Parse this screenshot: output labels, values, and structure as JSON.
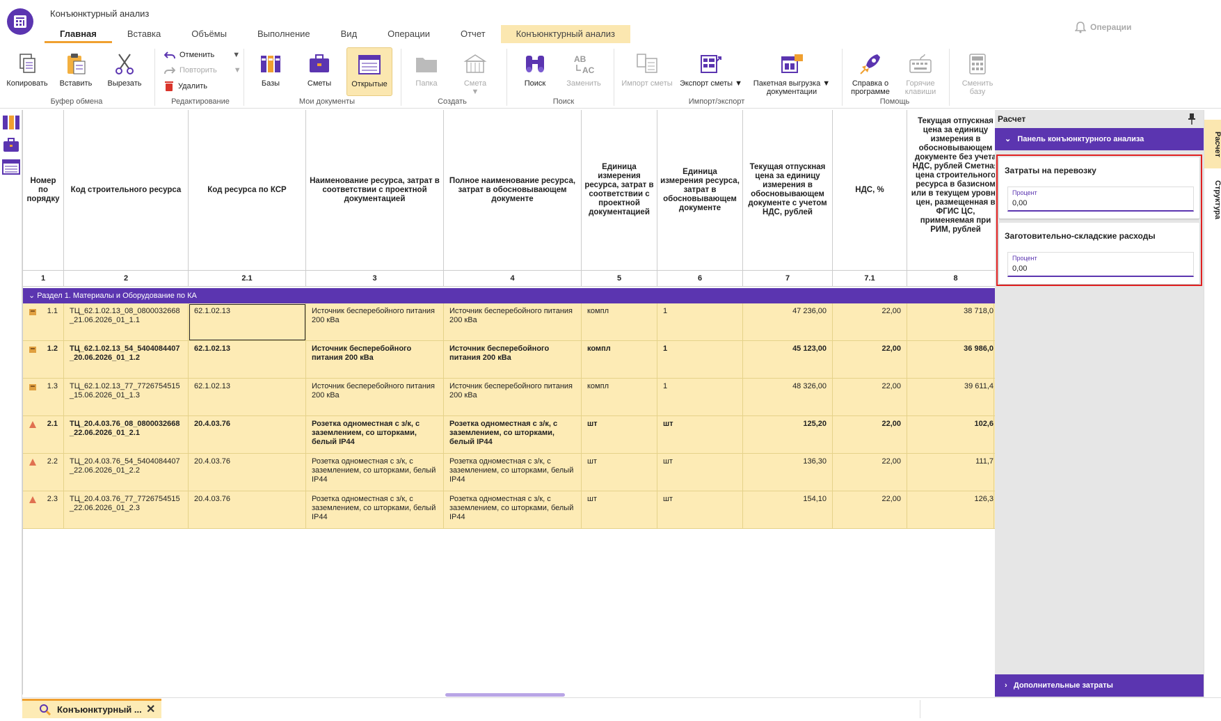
{
  "app": {
    "title": "Конъюнктурный анализ",
    "tabs": [
      "Главная",
      "Вставка",
      "Объёмы",
      "Выполнение",
      "Вид",
      "Операции",
      "Отчет",
      "Конъюнктурный анализ"
    ],
    "ops_label": "Операции"
  },
  "ribbon": {
    "copy": "Копировать",
    "paste": "Вставить",
    "cut": "Вырезать",
    "clipboard_group": "Буфер обмена",
    "undo": "Отменить",
    "redo": "Повторить",
    "delete": "Удалить",
    "edit_group": "Редактирование",
    "bases": "Базы",
    "estimates": "Сметы",
    "opened": "Открытые",
    "mydocs_group": "Мои документы",
    "folder": "Папка",
    "estimate": "Смета",
    "create_group": "Создать",
    "search": "Поиск",
    "replace": "Заменить",
    "search_group": "Поиск",
    "import_estimate": "Импорт сметы",
    "export_estimate": "Экспорт сметы",
    "batch_export_1": "Пакетная выгрузка",
    "batch_export_2": "документации",
    "import_export_group": "Импорт/экспорт",
    "help_1": "Справка о",
    "help_2": "программе",
    "hotkeys_1": "Горячие",
    "hotkeys_2": "клавиши",
    "help_group": "Помощь",
    "switch_base_1": "Сменить",
    "switch_base_2": "базу"
  },
  "grid": {
    "headers": [
      "Номер по порядку",
      "Код строительного ресурса",
      "Код ресурса по КСР",
      "Наименование ресурса, затрат в соответствии с проектной документацией",
      "Полное наименование ресурса, затрат в обосновывающем документе",
      "Единица измерения ресурса, затрат в соответствии с проектной документацией",
      "Единица измерения ресурса, затрат в обосновывающем документе",
      "Текущая отпускная цена за единицу измерения в обосновывающем документе с учетом НДС, рублей",
      "НДС, %",
      "Текущая отпускная цена за единицу измерения в обосновывающем документе без учета НДС, рублей Сметная цена строительного ресурса в базисном или в текущем уровне цен, размещенная в ФГИС ЦС, применяемая при РИМ, рублей"
    ],
    "numbers": [
      "1",
      "2",
      "2.1",
      "3",
      "4",
      "5",
      "6",
      "7",
      "7.1",
      "8"
    ],
    "section": "Раздел 1. Материалы и Оборудование по КА",
    "rows": [
      {
        "num": "1.1",
        "code": "ТЦ_62.1.02.13_08_0800032668 _21.06.2026_01_1.1",
        "ksr": "62.1.02.13",
        "name": "Источник бесперебойного питания 200 кВа",
        "full": "Источник бесперебойного питания 200 кВа",
        "unit1": "компл",
        "unit2": "1",
        "price": "47 236,00",
        "vat": "22,00",
        "net": "38 718,0"
      },
      {
        "num": "1.2",
        "code": "ТЦ_62.1.02.13_54_5404084407 _20.06.2026_01_1.2",
        "ksr": "62.1.02.13",
        "name": "Источник бесперебойного питания 200 кВа",
        "full": "Источник бесперебойного питания 200 кВа",
        "unit1": "компл",
        "unit2": "1",
        "price": "45 123,00",
        "vat": "22,00",
        "net": "36 986,0"
      },
      {
        "num": "1.3",
        "code": "ТЦ_62.1.02.13_77_7726754515 _15.06.2026_01_1.3",
        "ksr": "62.1.02.13",
        "name": "Источник бесперебойного питания 200 кВа",
        "full": "Источник бесперебойного питания 200 кВа",
        "unit1": "компл",
        "unit2": "1",
        "price": "48 326,00",
        "vat": "22,00",
        "net": "39 611,4"
      },
      {
        "num": "2.1",
        "code": "ТЦ_20.4.03.76_08_0800032668 _22.06.2026_01_2.1",
        "ksr": "20.4.03.76",
        "name": "Розетка одноместная с з/к, с заземлением, со шторками, белый IP44",
        "full": "Розетка одноместная с з/к, с заземлением, со шторками, белый IP44",
        "unit1": "шт",
        "unit2": "шт",
        "price": "125,20",
        "vat": "22,00",
        "net": "102,6"
      },
      {
        "num": "2.2",
        "code": "ТЦ_20.4.03.76_54_5404084407 _22.06.2026_01_2.2",
        "ksr": "20.4.03.76",
        "name": "Розетка одноместная с з/к, с заземлением, со шторками, белый IP44",
        "full": "Розетка одноместная с з/к, с заземлением, со шторками, белый IP44",
        "unit1": "шт",
        "unit2": "шт",
        "price": "136,30",
        "vat": "22,00",
        "net": "111,7"
      },
      {
        "num": "2.3",
        "code": "ТЦ_20.4.03.76_77_7726754515 _22.06.2026_01_2.3",
        "ksr": "20.4.03.76",
        "name": "Розетка одноместная с з/к, с заземлением, со шторками, белый IP44",
        "full": "Розетка одноместная с з/к, с заземлением, со шторками, белый IP44",
        "unit1": "шт",
        "unit2": "шт",
        "price": "154,10",
        "vat": "22,00",
        "net": "126,3"
      }
    ]
  },
  "panel": {
    "title": "Расчет",
    "header": "Панель конъюнктурного анализа",
    "transport": {
      "title": "Затраты на перевозку",
      "label": "Процент",
      "value": "0,00"
    },
    "storage": {
      "title": "Заготовительно-складские расходы",
      "label": "Процент",
      "value": "0,00"
    },
    "extra": "Дополнительные затраты"
  },
  "vtabs": [
    "Расчет",
    "Структура"
  ],
  "doc_tab": {
    "label": "Конъюнктурный ...",
    "close": "✕"
  },
  "colors": {
    "accent": "#5b35b0",
    "row": "#fdebb5",
    "orange": "#f0a030",
    "frame": "#e02020"
  }
}
